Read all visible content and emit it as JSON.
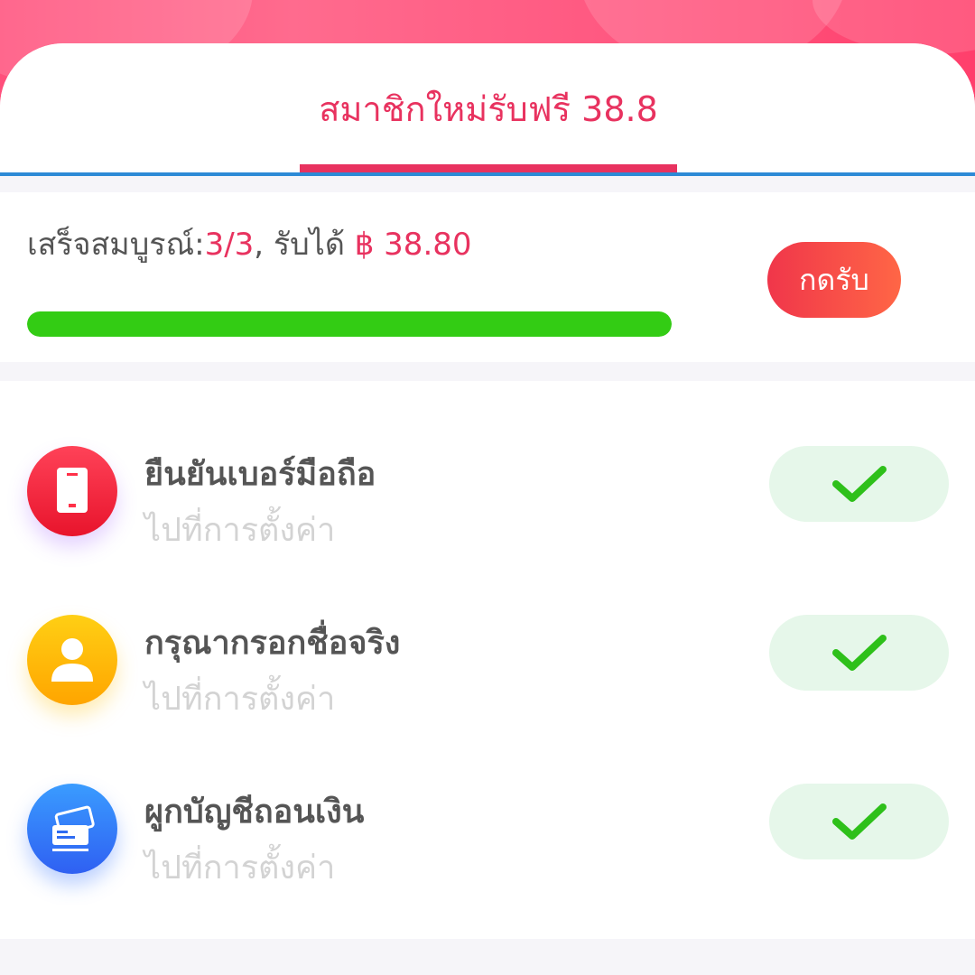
{
  "tab": {
    "label": "สมาชิกใหม่รับฟรี 38.8"
  },
  "progress": {
    "prefix": "เสร็จสมบูรณ์:",
    "count": "3/3",
    "middle": ", รับได้ ",
    "amount": "฿ 38.80",
    "percent": 100,
    "button_label": "กดรับ"
  },
  "tasks": [
    {
      "title": "ยืนยันเบอร์มือถือ",
      "subtitle": "ไปที่การตั้งค่า",
      "icon": "phone-icon",
      "status": "completed"
    },
    {
      "title": "กรุณากรอกชื่อจริง",
      "subtitle": "ไปที่การตั้งค่า",
      "icon": "user-icon",
      "status": "completed"
    },
    {
      "title": "ผูกบัญชีถอนเงิน",
      "subtitle": "ไปที่การตั้งค่า",
      "icon": "card-icon",
      "status": "completed"
    }
  ],
  "colors": {
    "accent": "#e8325f",
    "progress_fill": "#33cc14",
    "check": "#2ec01a"
  }
}
